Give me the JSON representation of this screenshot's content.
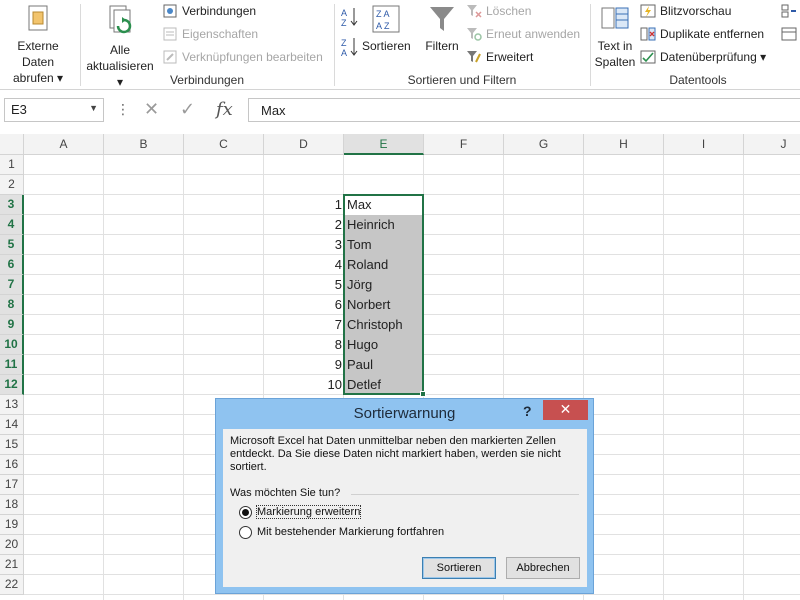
{
  "ribbon": {
    "external_data": {
      "line1": "Externe Daten",
      "line2": "abrufen ▾"
    },
    "refresh_all": {
      "line1": "Alle",
      "line2": "aktualisieren ▾"
    },
    "connections": {
      "connections": "Verbindungen",
      "properties": "Eigenschaften",
      "edit_links": "Verknüpfungen bearbeiten",
      "group_label": "Verbindungen"
    },
    "sort_filter": {
      "sort": "Sortieren",
      "filter": "Filtern",
      "clear": "Löschen",
      "reapply": "Erneut anwenden",
      "advanced": "Erweitert",
      "group_label": "Sortieren und Filtern"
    },
    "data_tools": {
      "text_to_columns_1": "Text in",
      "text_to_columns_2": "Spalten",
      "flash_fill": "Blitzvorschau",
      "remove_duplicates": "Duplikate entfernen",
      "data_validation": "Datenüberprüfung ▾",
      "group_label": "Datentools"
    }
  },
  "formula_bar": {
    "name_box": "E3",
    "content": "Max"
  },
  "columns": [
    "A",
    "B",
    "C",
    "D",
    "E",
    "F",
    "G",
    "H",
    "I",
    "J"
  ],
  "rows": [
    "1",
    "2",
    "3",
    "4",
    "5",
    "6",
    "7",
    "8",
    "9",
    "10",
    "11",
    "12",
    "13",
    "14",
    "15",
    "16",
    "17",
    "18",
    "19",
    "20",
    "21",
    "22"
  ],
  "data_rows": [
    {
      "num": "1",
      "name": "Max"
    },
    {
      "num": "2",
      "name": "Heinrich"
    },
    {
      "num": "3",
      "name": "Tom"
    },
    {
      "num": "4",
      "name": "Roland"
    },
    {
      "num": "5",
      "name": "Jörg"
    },
    {
      "num": "6",
      "name": "Norbert"
    },
    {
      "num": "7",
      "name": "Christoph"
    },
    {
      "num": "8",
      "name": "Hugo"
    },
    {
      "num": "9",
      "name": "Paul"
    },
    {
      "num": "10",
      "name": "Detlef"
    }
  ],
  "dialog": {
    "title": "Sortierwarnung",
    "help": "?",
    "close": "✕",
    "message": "Microsoft Excel hat Daten unmittelbar neben den markierten Zellen entdeckt. Da Sie diese Daten nicht markiert haben, werden sie nicht sortiert.",
    "question": "Was möchten Sie tun?",
    "option_expand": "Markierung erweitern",
    "option_continue": "Mit bestehender Markierung fortfahren",
    "sort_button": "Sortieren",
    "cancel_button": "Abbrechen"
  },
  "colors": {
    "accent": "#217346",
    "dialog_frame": "#8fc3f0",
    "close_button": "#c75050"
  }
}
